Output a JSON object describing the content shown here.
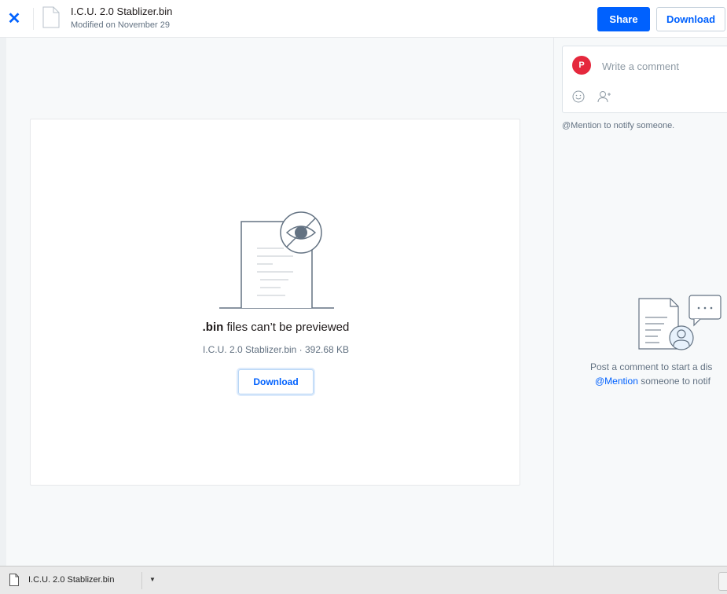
{
  "header": {
    "close_icon": "close-icon",
    "file_name": "I.C.U. 2.0 Stablizer.bin",
    "modified": "Modified on November 29",
    "share_label": "Share",
    "download_label": "Download"
  },
  "preview": {
    "title_ext": ".bin",
    "title_rest": " files can’t be previewed",
    "file_info": "I.C.U. 2.0 Stablizer.bin · 392.68 KB",
    "download_label": "Download"
  },
  "comments": {
    "avatar_initial": "P",
    "placeholder": "Write a comment",
    "mention_hint": "@Mention to notify someone.",
    "empty_line1": "Post a comment to start a dis",
    "empty_mention": "@Mention",
    "empty_line2_rest": " someone to notif"
  },
  "shelf": {
    "file_name": "I.C.U. 2.0 Stablizer.bin"
  },
  "colors": {
    "accent": "#0061fe",
    "avatar": "#e5283d"
  }
}
